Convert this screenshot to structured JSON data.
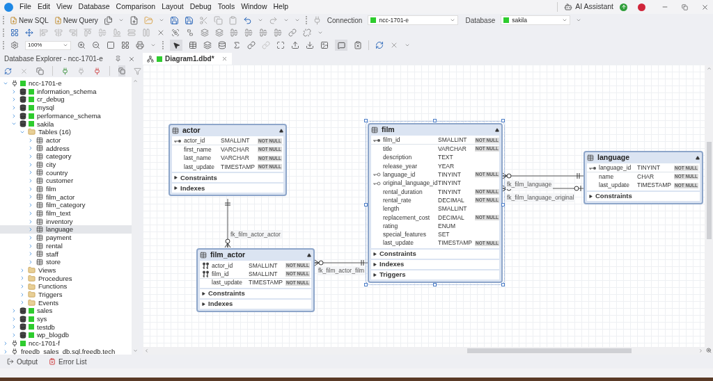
{
  "menu": [
    "File",
    "Edit",
    "View",
    "Database",
    "Comparison",
    "Layout",
    "Debug",
    "Tools",
    "Window",
    "Help"
  ],
  "ai_assistant": "AI Assistant",
  "toolbar": {
    "new_sql": "New SQL",
    "new_query": "New Query",
    "connection_label": "Connection",
    "connection": "ncc-1701-e",
    "database_label": "Database",
    "database": "sakila",
    "zoom": "100%"
  },
  "explorer": {
    "title": "Database Explorer - ncc-1701-e",
    "tree": [
      {
        "label": "ncc-1701-e",
        "kind": "server",
        "expanded": true,
        "selected": false,
        "children": [
          {
            "label": "information_schema",
            "kind": "database",
            "expanded": false,
            "selected": false
          },
          {
            "label": "cr_debug",
            "kind": "database",
            "expanded": false,
            "selected": false
          },
          {
            "label": "mysql",
            "kind": "database",
            "expanded": false,
            "selected": false
          },
          {
            "label": "performance_schema",
            "kind": "database",
            "expanded": false,
            "selected": false
          },
          {
            "label": "sakila",
            "kind": "database",
            "expanded": true,
            "selected": false,
            "children": [
              {
                "label": "Tables (16)",
                "kind": "folder",
                "expanded": true,
                "selected": false,
                "children": [
                  {
                    "label": "actor",
                    "kind": "table",
                    "expanded": false,
                    "selected": false
                  },
                  {
                    "label": "address",
                    "kind": "table",
                    "expanded": false,
                    "selected": false
                  },
                  {
                    "label": "category",
                    "kind": "table",
                    "expanded": false,
                    "selected": false
                  },
                  {
                    "label": "city",
                    "kind": "table",
                    "expanded": false,
                    "selected": false
                  },
                  {
                    "label": "country",
                    "kind": "table",
                    "expanded": false,
                    "selected": false
                  },
                  {
                    "label": "customer",
                    "kind": "table",
                    "expanded": false,
                    "selected": false
                  },
                  {
                    "label": "film",
                    "kind": "table",
                    "expanded": false,
                    "selected": false
                  },
                  {
                    "label": "film_actor",
                    "kind": "table",
                    "expanded": false,
                    "selected": false
                  },
                  {
                    "label": "film_category",
                    "kind": "table",
                    "expanded": false,
                    "selected": false
                  },
                  {
                    "label": "film_text",
                    "kind": "table",
                    "expanded": false,
                    "selected": false
                  },
                  {
                    "label": "inventory",
                    "kind": "table",
                    "expanded": false,
                    "selected": false
                  },
                  {
                    "label": "language",
                    "kind": "table",
                    "expanded": false,
                    "selected": true
                  },
                  {
                    "label": "payment",
                    "kind": "table",
                    "expanded": false,
                    "selected": false
                  },
                  {
                    "label": "rental",
                    "kind": "table",
                    "expanded": false,
                    "selected": false
                  },
                  {
                    "label": "staff",
                    "kind": "table",
                    "expanded": false,
                    "selected": false
                  },
                  {
                    "label": "store",
                    "kind": "table",
                    "expanded": false,
                    "selected": false
                  }
                ]
              },
              {
                "label": "Views",
                "kind": "folder",
                "expanded": false,
                "selected": false
              },
              {
                "label": "Procedures",
                "kind": "folder",
                "expanded": false,
                "selected": false
              },
              {
                "label": "Functions",
                "kind": "folder",
                "expanded": false,
                "selected": false
              },
              {
                "label": "Triggers",
                "kind": "folder",
                "expanded": false,
                "selected": false
              },
              {
                "label": "Events",
                "kind": "folder",
                "expanded": false,
                "selected": false
              }
            ]
          },
          {
            "label": "sales",
            "kind": "database",
            "expanded": false,
            "selected": false
          },
          {
            "label": "sys",
            "kind": "database",
            "expanded": false,
            "selected": false
          },
          {
            "label": "testdb",
            "kind": "database",
            "expanded": false,
            "selected": false
          },
          {
            "label": "wp_blogdb",
            "kind": "database",
            "expanded": false,
            "selected": false
          }
        ]
      },
      {
        "label": "ncc-1701-f",
        "kind": "server",
        "expanded": false,
        "selected": false
      },
      {
        "label": "freedb_sales_db.sql.freedb.tech",
        "kind": "server_off",
        "expanded": false,
        "selected": false
      }
    ]
  },
  "tabs": [
    {
      "label": "Diagram1.dbd*",
      "selected": true
    }
  ],
  "diagram": {
    "entities": [
      {
        "name": "actor",
        "selected": false,
        "columns": [
          {
            "name": "actor_id",
            "type": "SMALLINT",
            "badge": "NOT NULL",
            "kind": "pk"
          },
          {
            "name": "first_name",
            "type": "VARCHAR",
            "badge": "NOT NULL",
            "kind": "plain"
          },
          {
            "name": "last_name",
            "type": "VARCHAR",
            "badge": "NOT NULL",
            "kind": "plain"
          },
          {
            "name": "last_update",
            "type": "TIMESTAMP",
            "badge": "NOT NULL",
            "kind": "plain"
          }
        ],
        "sections": [
          "Constraints",
          "Indexes"
        ]
      },
      {
        "name": "film_actor",
        "selected": false,
        "columns": [
          {
            "name": "actor_id",
            "type": "SMALLINT",
            "badge": "NOT NULL",
            "kind": "pkfk"
          },
          {
            "name": "film_id",
            "type": "SMALLINT",
            "badge": "NOT NULL",
            "kind": "pkfk"
          },
          {
            "name": "last_update",
            "type": "TIMESTAMP",
            "badge": "NOT NULL",
            "kind": "plain"
          }
        ],
        "sections": [
          "Constraints",
          "Indexes"
        ]
      },
      {
        "name": "film",
        "selected": true,
        "columns": [
          {
            "name": "film_id",
            "type": "SMALLINT",
            "badge": "NOT NULL",
            "kind": "pk"
          },
          {
            "name": "title",
            "type": "VARCHAR",
            "badge": "NOT NULL",
            "kind": "plain"
          },
          {
            "name": "description",
            "type": "TEXT",
            "kind": "plain"
          },
          {
            "name": "release_year",
            "type": "YEAR",
            "kind": "plain"
          },
          {
            "name": "language_id",
            "type": "TINYINT",
            "badge": "NOT NULL",
            "kind": "fk"
          },
          {
            "name": "original_language_id",
            "type": "TINYINT",
            "kind": "fk"
          },
          {
            "name": "rental_duration",
            "type": "TINYINT",
            "badge": "NOT NULL",
            "kind": "plain"
          },
          {
            "name": "rental_rate",
            "type": "DECIMAL",
            "badge": "NOT NULL",
            "kind": "plain"
          },
          {
            "name": "length",
            "type": "SMALLINT",
            "kind": "plain"
          },
          {
            "name": "replacement_cost",
            "type": "DECIMAL",
            "badge": "NOT NULL",
            "kind": "plain"
          },
          {
            "name": "rating",
            "type": "ENUM",
            "kind": "plain"
          },
          {
            "name": "special_features",
            "type": "SET",
            "kind": "plain"
          },
          {
            "name": "last_update",
            "type": "TIMESTAMP",
            "badge": "NOT NULL",
            "kind": "plain"
          }
        ],
        "sections": [
          "Constraints",
          "Indexes",
          "Triggers"
        ]
      },
      {
        "name": "language",
        "selected": false,
        "columns": [
          {
            "name": "language_id",
            "type": "TINYINT",
            "badge": "NOT NULL",
            "kind": "pk"
          },
          {
            "name": "name",
            "type": "CHAR",
            "badge": "NOT NULL",
            "kind": "plain"
          },
          {
            "name": "last_update",
            "type": "TIMESTAMP",
            "badge": "NOT NULL",
            "kind": "plain"
          }
        ],
        "sections": [
          "Constraints"
        ]
      }
    ],
    "relations": [
      {
        "label": "fk_film_actor_actor"
      },
      {
        "label": "fk_film_actor_film"
      },
      {
        "label": "fk_film_language"
      },
      {
        "label": "fk_film_language_original"
      }
    ]
  },
  "bottom_tabs": [
    "Output",
    "Error List"
  ]
}
